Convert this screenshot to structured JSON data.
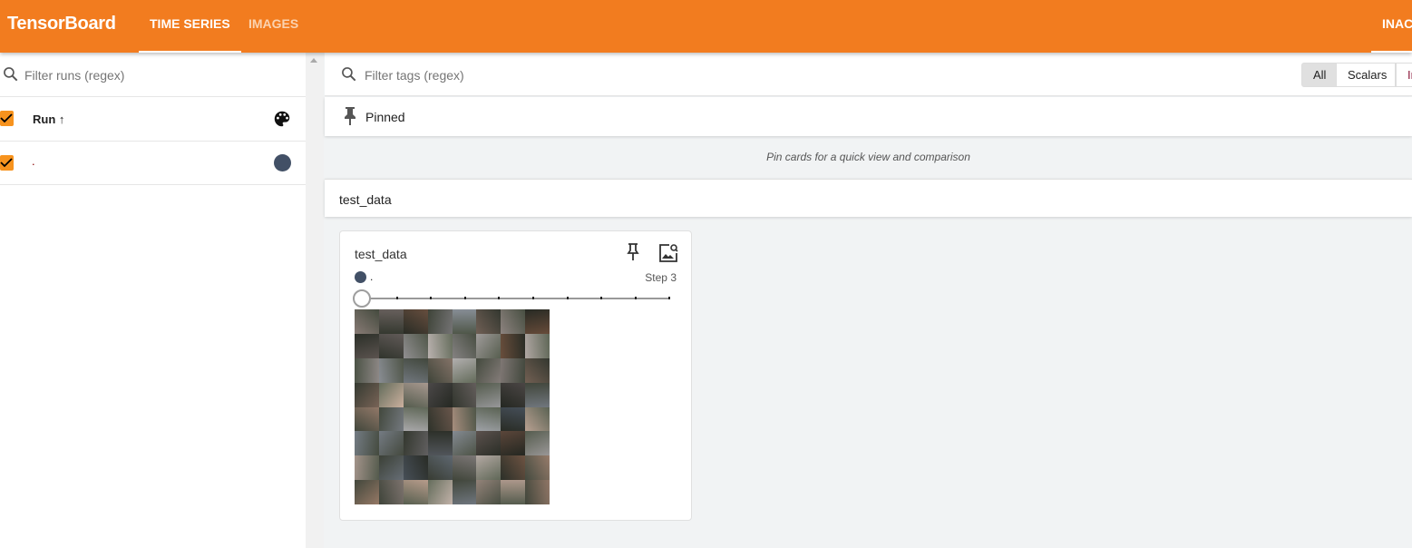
{
  "header": {
    "title": "TensorBoard",
    "tabs": [
      {
        "label": "TIME SERIES",
        "active": true
      },
      {
        "label": "IMAGES",
        "active": false
      }
    ],
    "right_tab": "INAC"
  },
  "sidebar": {
    "filter_placeholder": "Filter runs (regex)",
    "column_header": "Run ↑",
    "runs": [
      {
        "name": ".",
        "checked": true,
        "color": "#425066"
      }
    ]
  },
  "main": {
    "filter_placeholder": "Filter tags (regex)",
    "type_filters": [
      "All",
      "Scalars",
      "In"
    ],
    "active_filter": "All",
    "pinned": {
      "title": "Pinned",
      "empty_message": "Pin cards for a quick view and comparison"
    },
    "group": {
      "title": "test_data"
    },
    "card": {
      "title": "test_data",
      "run": ".",
      "run_color": "#425066",
      "step_label": "Step 3",
      "slider_value": 0
    }
  },
  "colors": {
    "accent": "#f27c1f",
    "checkbox": "#f7931e"
  }
}
